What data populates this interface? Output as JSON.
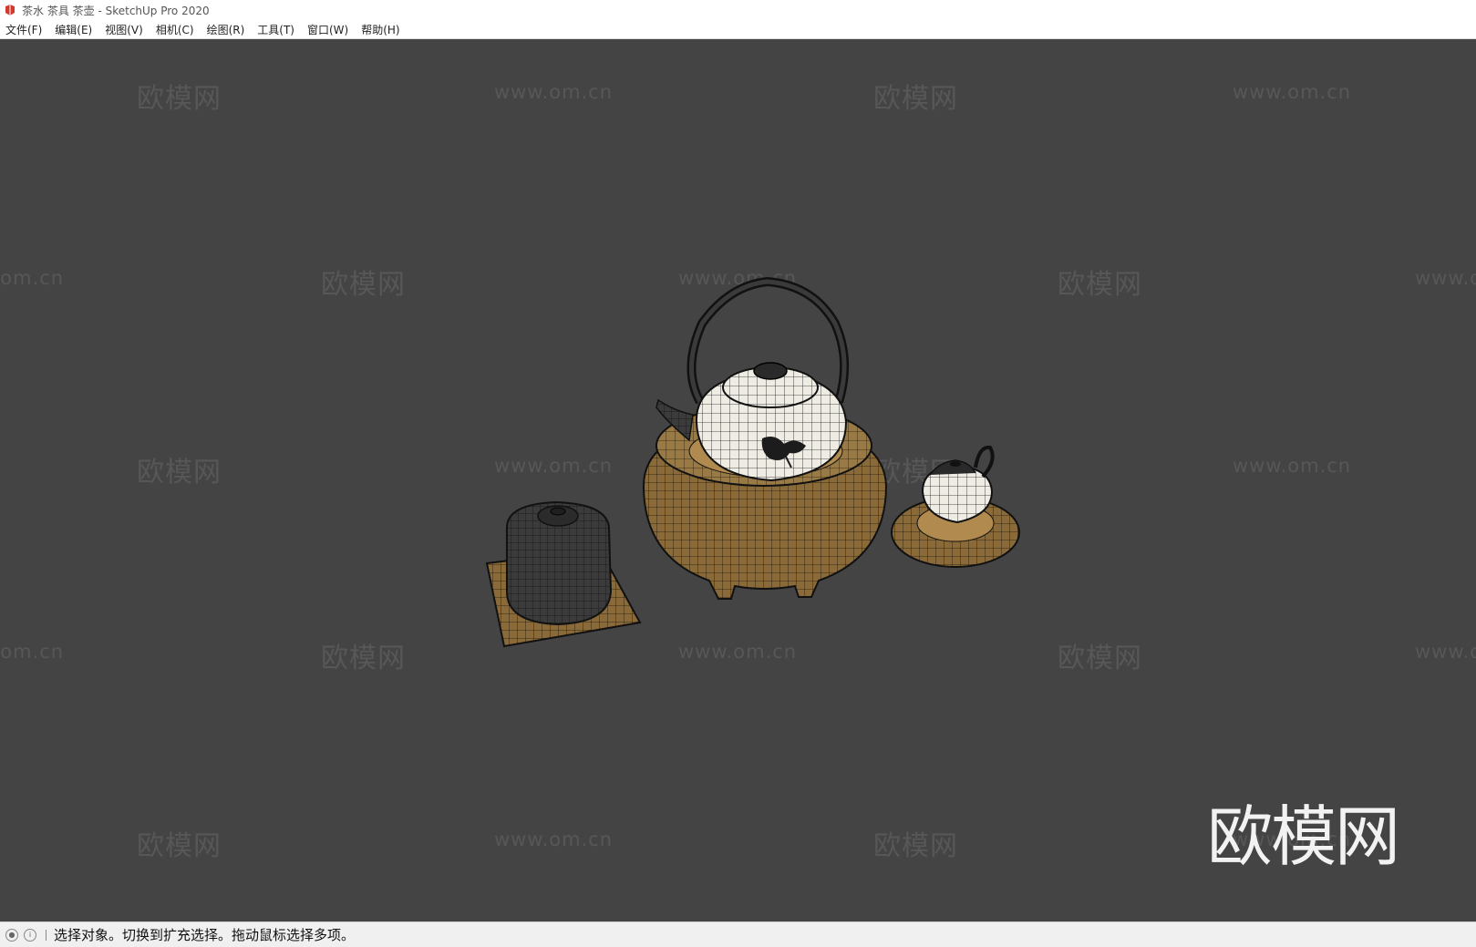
{
  "window": {
    "title": "茶水 茶具 茶壶 - SketchUp Pro 2020",
    "app_icon": "sketchup-icon"
  },
  "menu": {
    "items": [
      "文件(F)",
      "编辑(E)",
      "视图(V)",
      "相机(C)",
      "绘图(R)",
      "工具(T)",
      "窗口(W)",
      "帮助(H)"
    ]
  },
  "viewport": {
    "background": "#444444",
    "watermark_cn": "欧模网",
    "watermark_url": "www.om.cn",
    "brand_logo": "欧模网"
  },
  "status": {
    "icons": [
      "geo-location-icon",
      "info-icon"
    ],
    "text": "选择对象。切换到扩充选择。拖动鼠标选择多项。"
  },
  "colors": {
    "wood": "#8a6a38",
    "wire_dark": "#1a1a1a",
    "ceramic": "#efece4",
    "pot_dark": "#3b3b3b"
  }
}
